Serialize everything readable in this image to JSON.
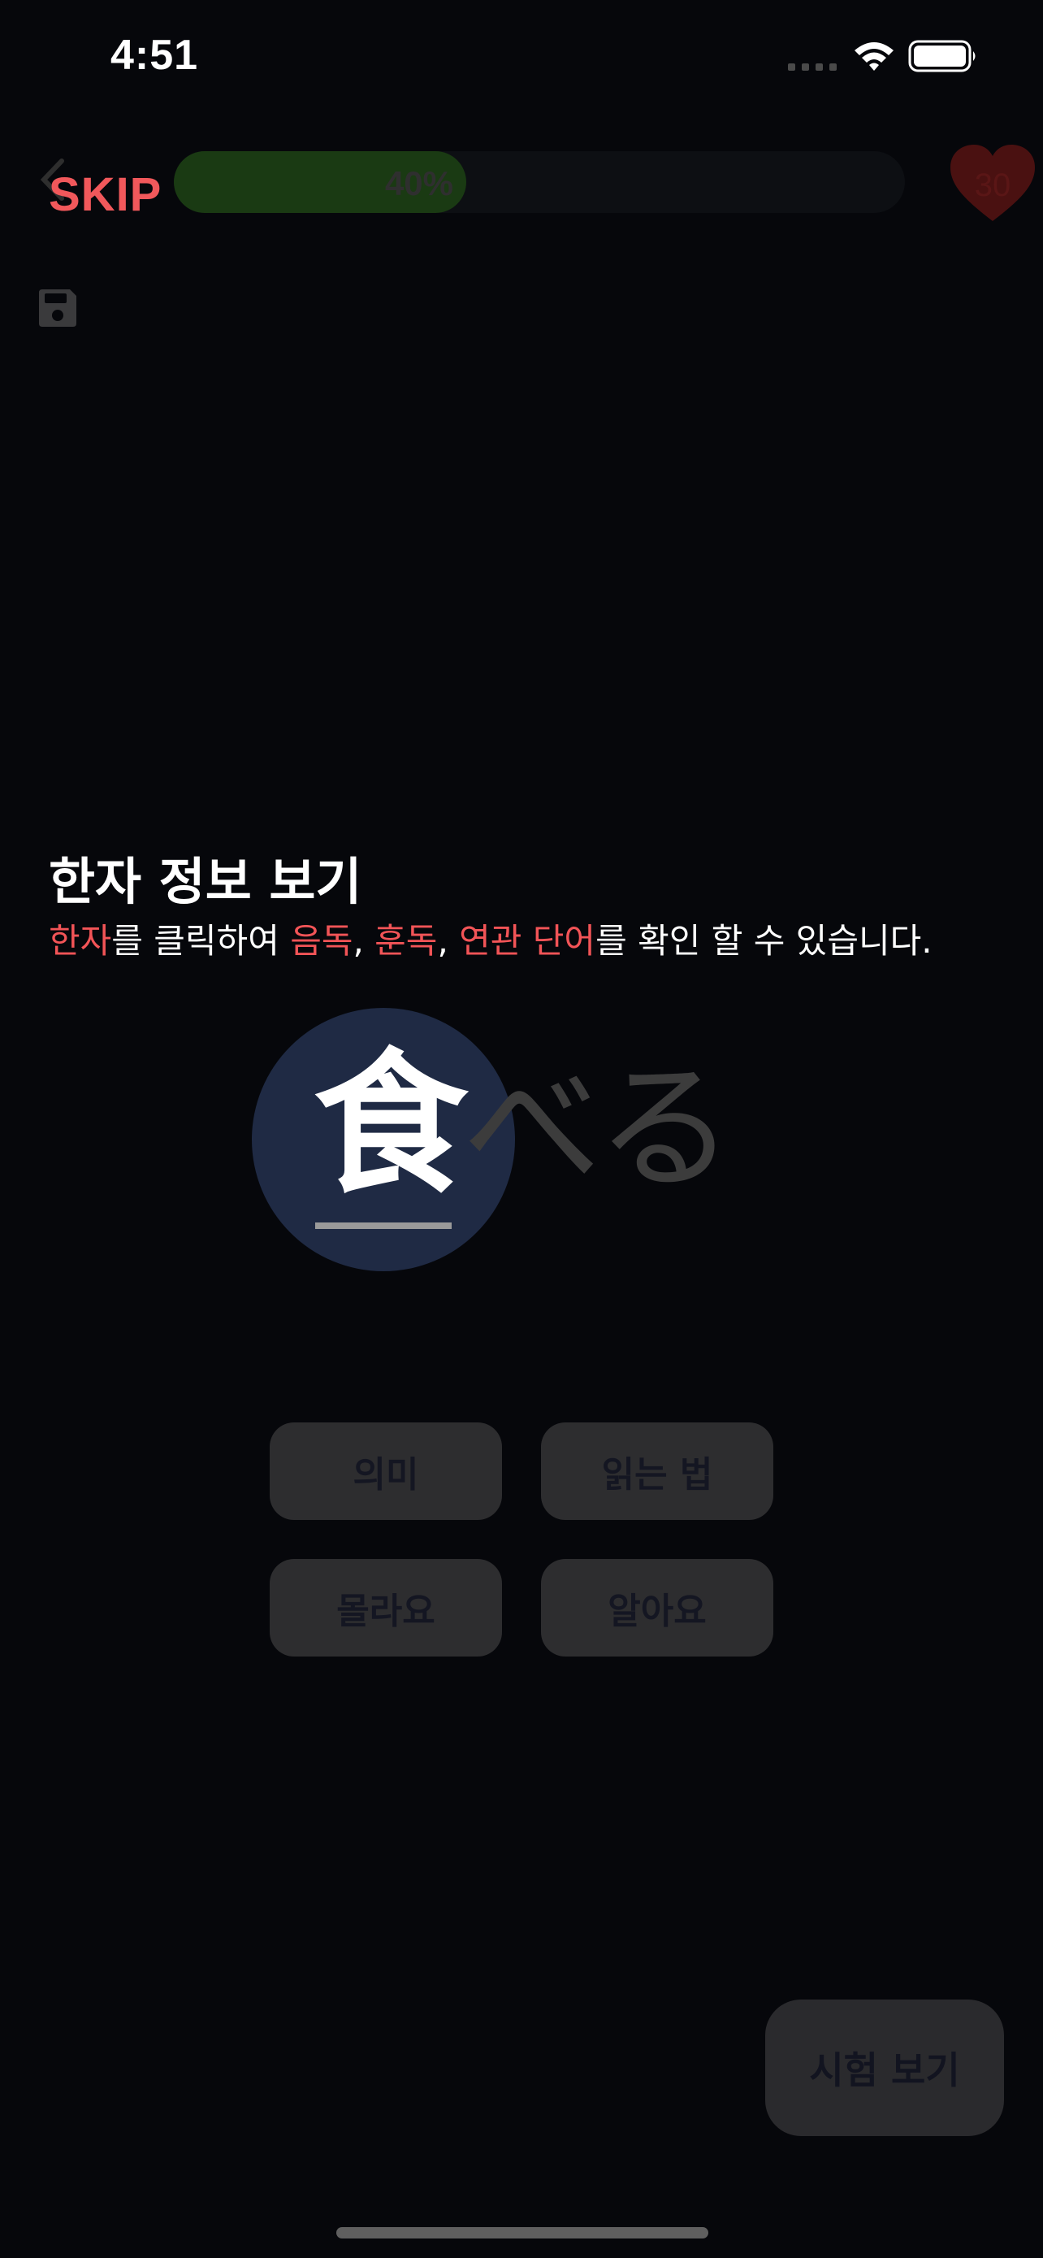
{
  "status_bar": {
    "time": "4:51",
    "icons": [
      "signal-dots-icon",
      "wifi-icon",
      "battery-icon"
    ]
  },
  "nav": {
    "skip_label": "SKIP",
    "progress": 0.4,
    "progress_label": "40%",
    "hearts": "30"
  },
  "guide": {
    "title": "한자 정보 보기",
    "desc": {
      "p1": "한자",
      "p2": "를 클릭하여 ",
      "p3": "음독",
      "p4": ", ",
      "p5": "훈독",
      "p6": ", ",
      "p7": "연관 단어",
      "p8": "를 확인 할 수 있습니다."
    }
  },
  "word": {
    "kanji": "食",
    "okurigana": "べる"
  },
  "actions": {
    "meaning": "의미",
    "reading": "읽는 법",
    "dont_know": "몰라요",
    "know": "알아요"
  },
  "exam_button": "시험 보기",
  "colors": {
    "background": "#06070b",
    "accent": "#f1585b",
    "spotlight": "#1f2a44",
    "progress_fill": "#1a3a13",
    "heart": "#4a1111"
  }
}
